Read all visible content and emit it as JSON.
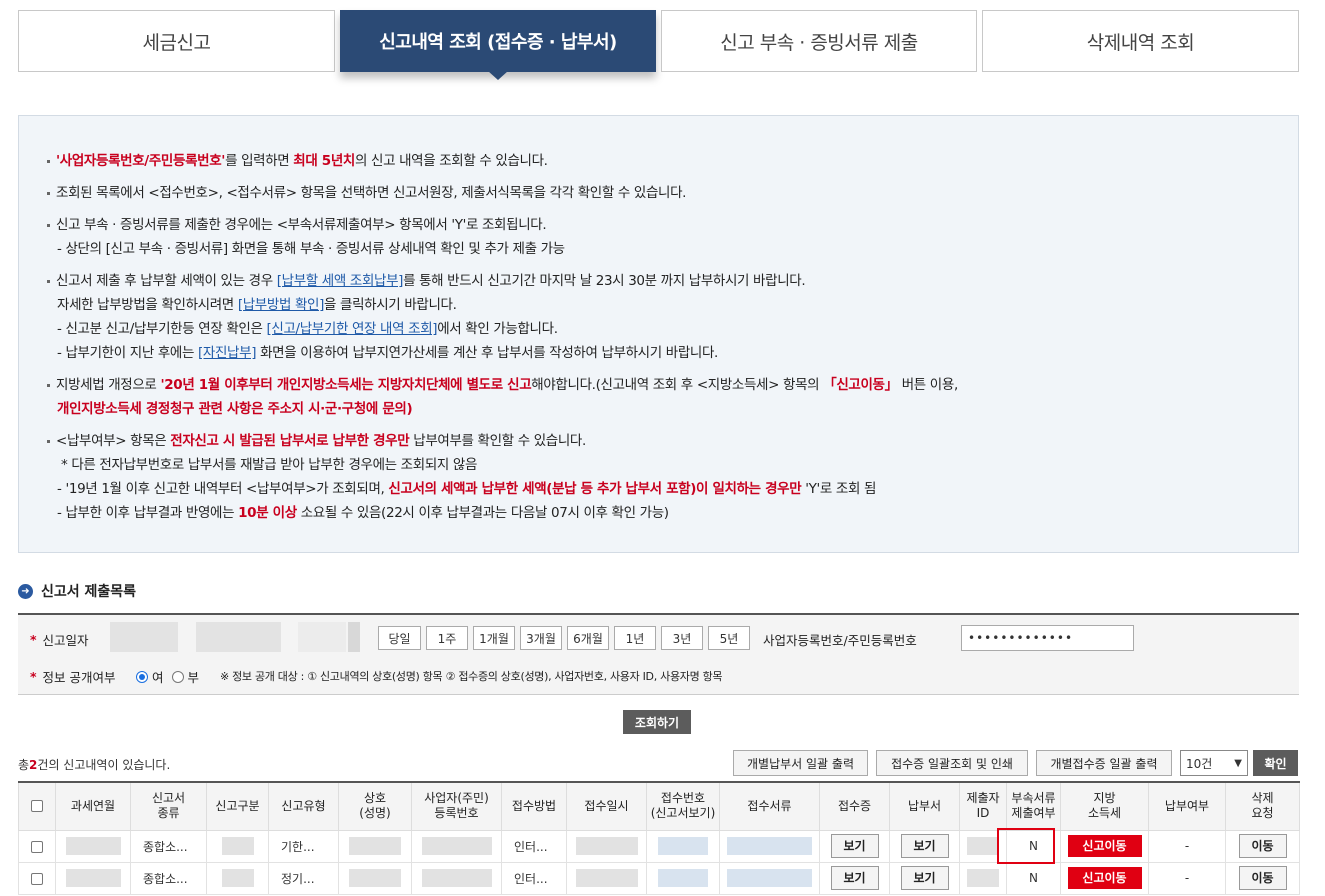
{
  "tabs": [
    {
      "label": "세금신고"
    },
    {
      "label": "신고내역 조회 (접수증 · 납부서)"
    },
    {
      "label": "신고 부속 · 증빙서류 제출"
    },
    {
      "label": "삭제내역 조회"
    }
  ],
  "info": {
    "l1_a": "'사업자등록번호/주민등록번호'",
    "l1_b": "를 입력하면 ",
    "l1_c": "최대 5년치",
    "l1_d": "의 신고 내역을 조회할 수 있습니다.",
    "l2": "조회된 목록에서 <접수번호>, <접수서류> 항목을 선택하면 신고서원장, 제출서식목록을 각각 확인할 수 있습니다.",
    "l3": "신고 부속 · 증빙서류를 제출한 경우에는 <부속서류제출여부> 항목에서 'Y'로 조회됩니다.",
    "l4": "- 상단의 [신고 부속 · 증빙서류] 화면을 통해 부속 · 증빙서류 상세내역 확인 및 추가 제출 가능",
    "l5_a": "신고서 제출 후 납부할 세액이 있는 경우 ",
    "l5_link": "[납부할 세액 조회납부]",
    "l5_b": "를 통해 반드시 신고기간 마지막 날 23시 30분 까지 납부하시기 바랍니다.",
    "l6_a": "자세한 납부방법을 확인하시려면 ",
    "l6_link": "[납부방법 확인]",
    "l6_b": "을 클릭하시기 바랍니다.",
    "l7_a": "- 신고분 신고/납부기한등 연장 확인은 ",
    "l7_link": "[신고/납부기한 연장 내역 조회]",
    "l7_b": "에서 확인 가능합니다.",
    "l8_a": "- 납부기한이 지난 후에는 ",
    "l8_link": "[자진납부]",
    "l8_b": " 화면을 이용하여 납부지연가산세를 계산 후 납부서를 작성하여 납부하시기 바랍니다.",
    "l9_a": "지방세법 개정으로 ",
    "l9_b": "'20년 1월 이후부터 개인지방소득세는 지방자치단체에 별도로 신고",
    "l9_c": "해야합니다.(신고내역 조회 후 <지방소득세> 항목의 ",
    "l9_d": "「신고이동」",
    "l9_e": " 버튼 이용,",
    "l10": "개인지방소득세 경정청구 관련 사항은 주소지 시·군·구청에 문의)",
    "l11_a": "<납부여부> 항목은 ",
    "l11_b": "전자신고 시 발급된 납부서로 납부한 경우만",
    "l11_c": " 납부여부를 확인할 수 있습니다.",
    "l12": "* 다른 전자납부번호로 납부서를 재발급 받아 납부한 경우에는 조회되지 않음",
    "l13_a": "- '19년 1월 이후 신고한 내역부터 <납부여부>가 조회되며, ",
    "l13_b": "신고서의 세액과 납부한 세액(분납 등 추가 납부서 포함)이 일치하는 경우만",
    "l13_c": " 'Y'로 조회 됨",
    "l14_a": "- 납부한 이후 납부결과 반영에는 ",
    "l14_b": "10분 이상",
    "l14_c": " 소요될 수 있음(22시 이후 납부결과는 다음날 07시 이후 확인 가능)"
  },
  "section_title": "신고서 제출목록",
  "search": {
    "date_label": "신고일자",
    "period_buttons": [
      "당일",
      "1주",
      "1개월",
      "3개월",
      "6개월",
      "1년",
      "3년",
      "5년"
    ],
    "id_label": "사업자등록번호/주민등록번호",
    "id_value": "•••••••••••••",
    "disclosure_label": "정보 공개여부",
    "opt_yes": "여",
    "opt_no": "부",
    "disclosure_note": "※ 정보 공개 대상 : ① 신고내역의 상호(성명) 항목 ② 접수증의 상호(성명), 사업자번호, 사용자 ID, 사용자명 항목"
  },
  "query_button": "조회하기",
  "result": {
    "prefix": "총",
    "count": "2",
    "suffix": "건의 신고내역이 있습니다."
  },
  "toolbar": {
    "btn1": "개별납부서 일괄 출력",
    "btn2": "접수증 일괄조회 및 인쇄",
    "btn3": "개별접수증 일괄 출력",
    "page_size": "10건",
    "confirm": "확인"
  },
  "table": {
    "headers": [
      "",
      "과세연월",
      "신고서\n종류",
      "신고구분",
      "신고유형",
      "상호\n(성명)",
      "사업자(주민)\n등록번호",
      "접수방법",
      "접수일시",
      "접수번호\n(신고서보기)",
      "접수서류",
      "접수증",
      "납부서",
      "제출자\nID",
      "부속서류\n제출여부",
      "지방\n소득세",
      "납부여부",
      "삭제\n요청"
    ],
    "rows": [
      {
        "kind": "종합소...",
        "type": "기한...",
        "method": "인터...",
        "receipt": "보기",
        "payment": "보기",
        "attach": "N",
        "local": "신고이동",
        "paid": "-",
        "delete": "이동"
      },
      {
        "kind": "종합소...",
        "type": "정기...",
        "method": "인터...",
        "receipt": "보기",
        "payment": "보기",
        "attach": "N",
        "local": "신고이동",
        "paid": "-",
        "delete": "이동"
      }
    ]
  },
  "colors": {
    "tab_active": "#2b4a75",
    "accent_red": "#c8001e",
    "button_red": "#e00012"
  }
}
